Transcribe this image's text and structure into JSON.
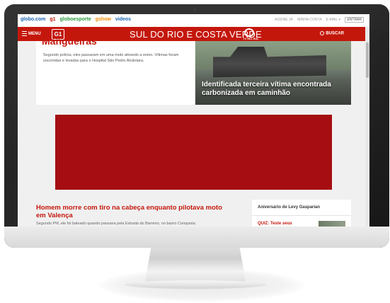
{
  "topbar": {
    "links": [
      {
        "label": "globo.com",
        "color": "#1a64b4"
      },
      {
        "label": "g1",
        "color": "#c4170c"
      },
      {
        "label": "globoesporte",
        "color": "#2a9a3c"
      },
      {
        "label": "gshow",
        "color": "#f28c00"
      },
      {
        "label": "videos",
        "color": "#1a64b4"
      }
    ],
    "right": [
      "ASSINE JÁ",
      "MINHA CONTA",
      "E-MAIL ▾"
    ],
    "entrar": "ENTRAR"
  },
  "nav": {
    "menu": "MENU",
    "logo": "G1",
    "title": "SUL DO RIO E COSTA VERDE",
    "tv_logo_text": "TV RIO SUL",
    "buscar": "BUSCAR"
  },
  "stories": {
    "story1_head": "Mangueiras",
    "story1_summary": "Segundo polícia, eles passaram em uma moto atirando a esmo. Vítimas foram socorridas e levadas para o Hospital São Pedro Alcântara.",
    "story2_caption": "Identificada terceira vítima encontrada carbonizada em caminhão",
    "story3_head": "Homem morre com tiro na cabeça enquanto pilotava moto em Valença",
    "story3_summary": "Segundo PM, ele foi baleado quando passava pela Estrada do Barreiro, no bairro Conquista."
  },
  "sidebar": {
    "heading": "Aniversário de Levy Gasparian",
    "quiz": "QUIZ: Teste seus"
  },
  "colors": {
    "brand": "#c4170c",
    "ad": "#a50d12"
  }
}
